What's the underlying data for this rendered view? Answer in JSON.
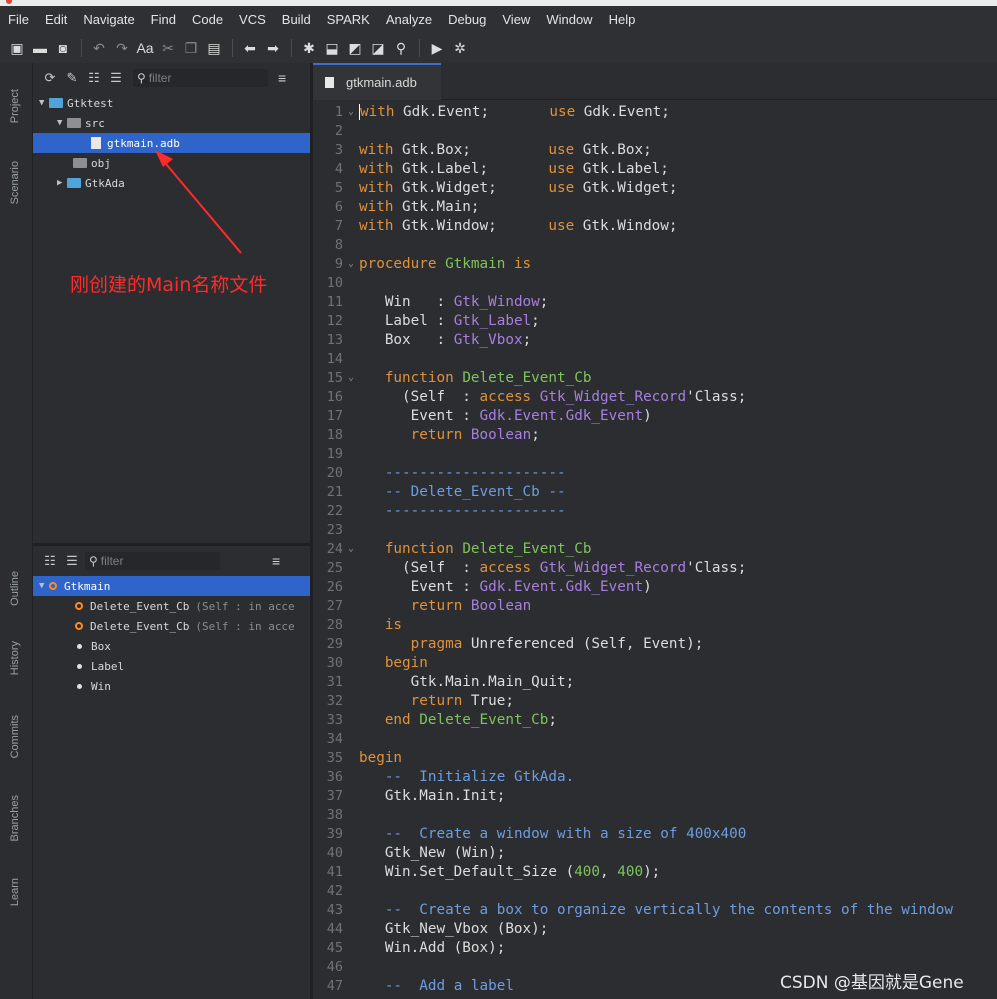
{
  "menu": [
    "File",
    "Edit",
    "Navigate",
    "Find",
    "Code",
    "VCS",
    "Build",
    "SPARK",
    "Analyze",
    "Debug",
    "View",
    "Window",
    "Help"
  ],
  "toolbar_icons": [
    "new-file-icon",
    "open-folder-icon",
    "save-icon",
    "undo-icon",
    "redo-icon",
    "font-icon",
    "cut-icon",
    "copy-icon",
    "paste-icon",
    "back-icon",
    "forward-icon",
    "build-icon",
    "build-all-icon",
    "run-icon",
    "run-all-icon",
    "clean-icon",
    "play-icon",
    "debug-icon"
  ],
  "side_tabs_top": [
    "Project",
    "Scenario"
  ],
  "side_tabs_bottom": [
    "Outline",
    "History",
    "Commits",
    "Branches",
    "Learn"
  ],
  "project": {
    "filter_placeholder": "filter",
    "tree": [
      {
        "label": "Gtktest",
        "level": 0,
        "kind": "folder"
      },
      {
        "label": "src",
        "level": 1,
        "kind": "folder-gray"
      },
      {
        "label": "gtkmain.adb",
        "level": 2,
        "kind": "file",
        "selected": true
      },
      {
        "label": "obj",
        "level": 1,
        "kind": "folder-gray"
      },
      {
        "label": "GtkAda",
        "level": 1,
        "kind": "folder"
      }
    ]
  },
  "annotation": "刚创建的Main名称文件",
  "outline": {
    "filter_placeholder": "filter",
    "items": [
      {
        "label": "Gtkmain",
        "sig": ""
      },
      {
        "label": "Delete_Event_Cb",
        "sig": "(Self : in acce"
      },
      {
        "label": "Delete_Event_Cb",
        "sig": "(Self : in acce"
      },
      {
        "label": "Box",
        "sig": ""
      },
      {
        "label": "Label",
        "sig": ""
      },
      {
        "label": "Win",
        "sig": ""
      }
    ]
  },
  "editor": {
    "tab_label": "gtkmain.adb",
    "line_numbers": [
      "1",
      "2",
      "3",
      "4",
      "5",
      "6",
      "7",
      "8",
      "9",
      "10",
      "11",
      "12",
      "13",
      "14",
      "15",
      "16",
      "17",
      "18",
      "19",
      "20",
      "21",
      "22",
      "23",
      "24",
      "25",
      "26",
      "27",
      "28",
      "29",
      "30",
      "31",
      "32",
      "33",
      "34",
      "35",
      "36",
      "37",
      "38",
      "39",
      "40",
      "41",
      "42",
      "43",
      "44",
      "45",
      "46",
      "47"
    ]
  },
  "watermark": "CSDN @基因就是Gene",
  "colors": {
    "selection": "#2f65ca",
    "keyword": "#e0913a",
    "type": "#a87fe0",
    "function": "#7fc45a",
    "comment": "#6e9de0",
    "annotation": "#ff2b2b"
  }
}
